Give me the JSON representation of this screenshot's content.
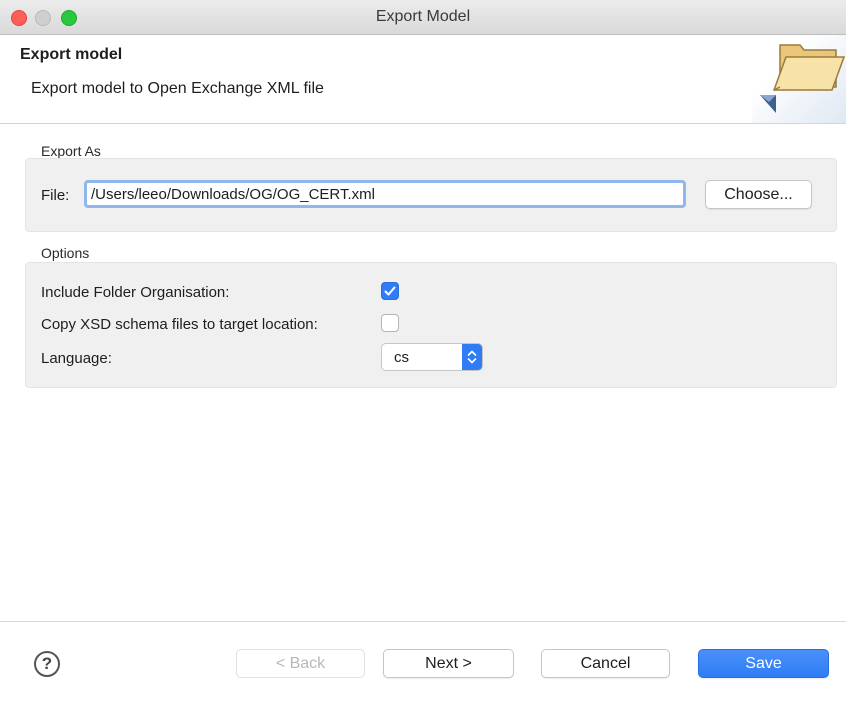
{
  "window": {
    "title": "Export Model"
  },
  "header": {
    "title": "Export model",
    "description": "Export model to Open Exchange XML file",
    "icon": "folder-icon"
  },
  "export_as": {
    "section_label": "Export As",
    "file_label": "File:",
    "file_value": "/Users/leeo/Downloads/OG/OG_CERT.xml",
    "choose_label": "Choose..."
  },
  "options": {
    "section_label": "Options",
    "include_folder_label": "Include Folder Organisation:",
    "include_folder_checked": true,
    "copy_xsd_label": "Copy XSD schema files to target location:",
    "copy_xsd_checked": false,
    "language_label": "Language:",
    "language_value": "cs"
  },
  "footer": {
    "help_label": "?",
    "back_label": "< Back",
    "next_label": "Next >",
    "cancel_label": "Cancel",
    "save_label": "Save"
  },
  "colors": {
    "accent": "#2f7cf6",
    "close": "#ff5f57",
    "maximize": "#28c840"
  }
}
